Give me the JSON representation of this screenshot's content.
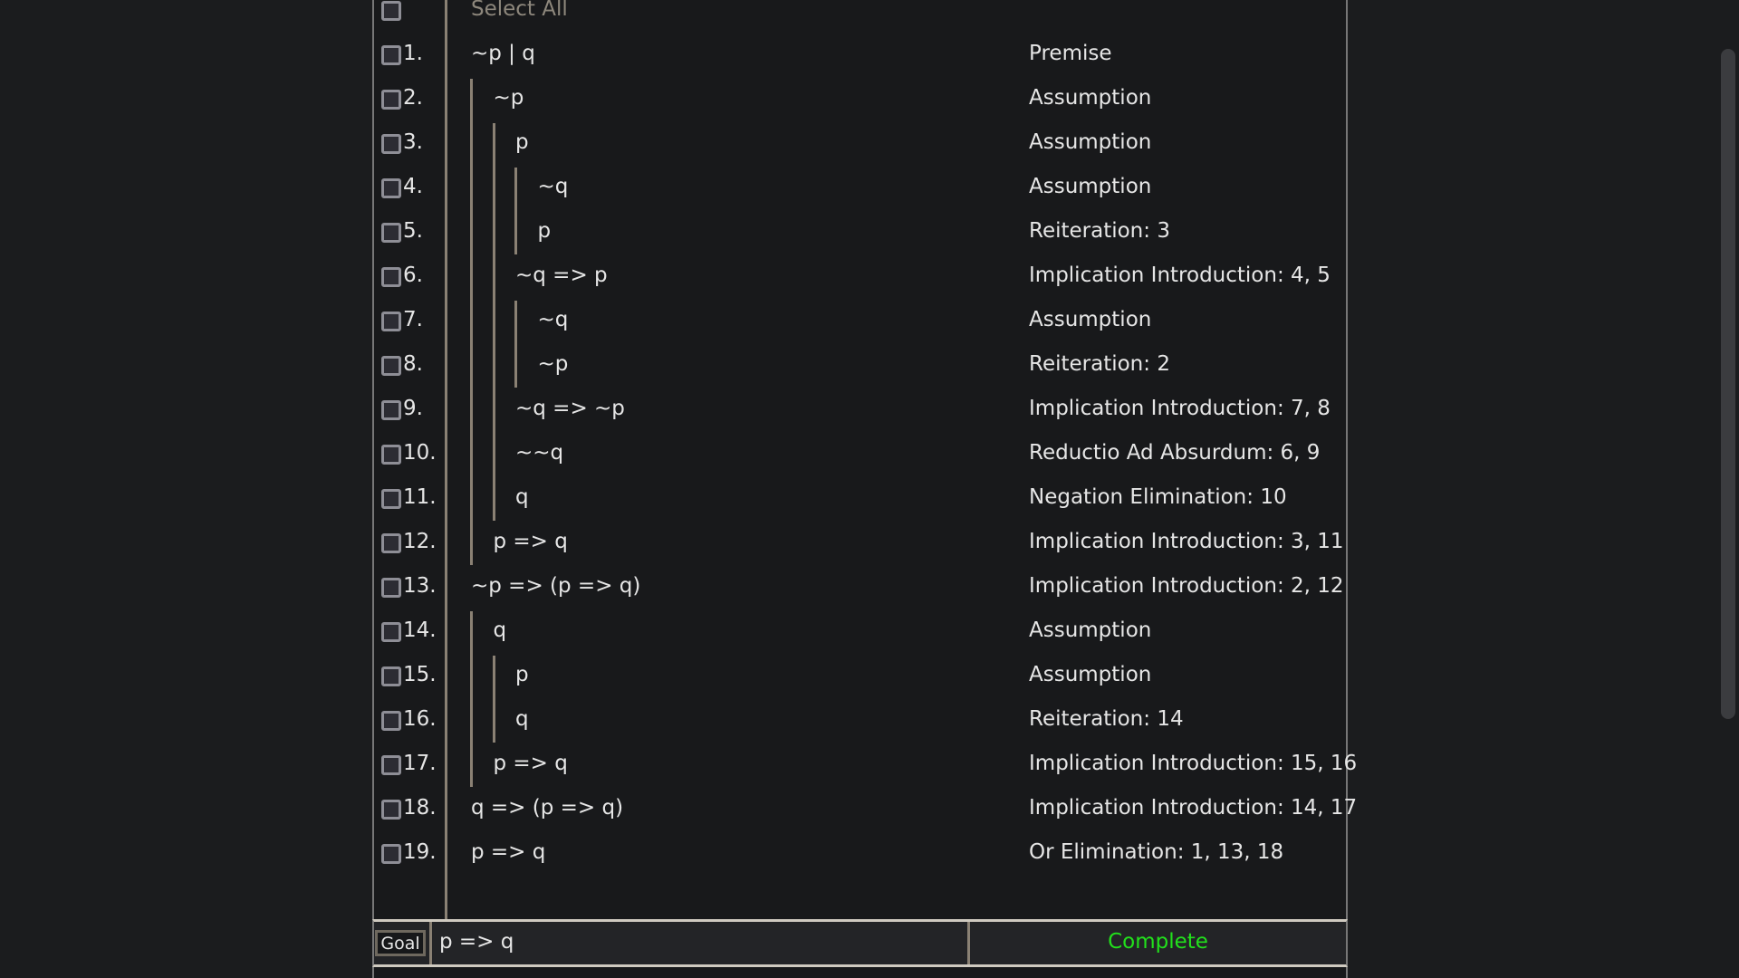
{
  "select_all_label": "Select All",
  "rows": [
    {
      "num": "1.",
      "formula": "~p | q",
      "depth": 0,
      "justification": "Premise"
    },
    {
      "num": "2.",
      "formula": "~p",
      "depth": 1,
      "justification": "Assumption"
    },
    {
      "num": "3.",
      "formula": "p",
      "depth": 2,
      "justification": "Assumption"
    },
    {
      "num": "4.",
      "formula": "~q",
      "depth": 3,
      "justification": "Assumption"
    },
    {
      "num": "5.",
      "formula": "p",
      "depth": 3,
      "justification": "Reiteration: 3"
    },
    {
      "num": "6.",
      "formula": "~q => p",
      "depth": 2,
      "justification": "Implication Introduction: 4, 5"
    },
    {
      "num": "7.",
      "formula": "~q",
      "depth": 3,
      "justification": "Assumption"
    },
    {
      "num": "8.",
      "formula": "~p",
      "depth": 3,
      "justification": "Reiteration: 2"
    },
    {
      "num": "9.",
      "formula": "~q => ~p",
      "depth": 2,
      "justification": "Implication Introduction: 7, 8"
    },
    {
      "num": "10.",
      "formula": "~~q",
      "depth": 2,
      "justification": "Reductio Ad Absurdum: 6, 9"
    },
    {
      "num": "11.",
      "formula": "q",
      "depth": 2,
      "justification": "Negation Elimination: 10"
    },
    {
      "num": "12.",
      "formula": "p => q",
      "depth": 1,
      "justification": "Implication Introduction: 3, 11"
    },
    {
      "num": "13.",
      "formula": "~p => (p => q)",
      "depth": 0,
      "justification": "Implication Introduction: 2, 12"
    },
    {
      "num": "14.",
      "formula": "q",
      "depth": 1,
      "justification": "Assumption"
    },
    {
      "num": "15.",
      "formula": "p",
      "depth": 2,
      "justification": "Assumption"
    },
    {
      "num": "16.",
      "formula": "q",
      "depth": 2,
      "justification": "Reiteration: 14"
    },
    {
      "num": "17.",
      "formula": "p => q",
      "depth": 1,
      "justification": "Implication Introduction: 15, 16"
    },
    {
      "num": "18.",
      "formula": "q => (p => q)",
      "depth": 0,
      "justification": "Implication Introduction: 14, 17"
    },
    {
      "num": "19.",
      "formula": "p => q",
      "depth": 0,
      "justification": "Or Elimination: 1, 13, 18"
    }
  ],
  "goal": {
    "label": "Goal",
    "value": "p => q",
    "status": "Complete",
    "status_color": "#22e01c"
  },
  "colors": {
    "background": "#18191b",
    "bar": "#8a8174",
    "text": "#e6e6e6"
  }
}
